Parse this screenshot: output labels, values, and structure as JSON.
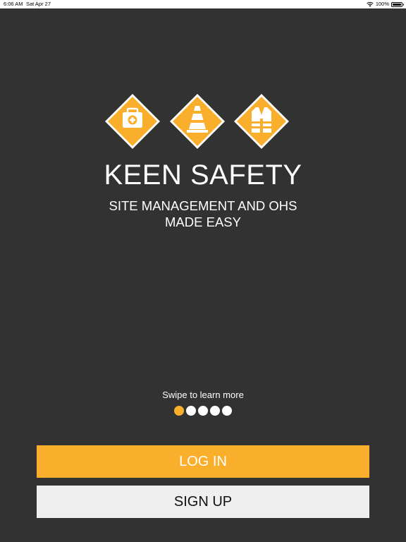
{
  "status_bar": {
    "time": "6:06 AM",
    "date": "Sat Apr 27",
    "battery": "100%",
    "wifi_icon": "wifi-icon",
    "battery_icon": "battery-icon"
  },
  "logo": {
    "icons": [
      "first-aid-kit-icon",
      "traffic-cone-icon",
      "safety-vest-icon"
    ],
    "accent_color": "#f9ae2c"
  },
  "brand": {
    "title": "KEEN SAFETY",
    "tagline_line1": "SITE MANAGEMENT AND OHS",
    "tagline_line2": "MADE EASY"
  },
  "onboarding": {
    "hint": "Swipe to learn more",
    "total_pages": 5,
    "current_page": 1
  },
  "buttons": {
    "login": "LOG IN",
    "signup": "SIGN UP"
  },
  "colors": {
    "background": "#333233",
    "accent": "#f9ae2c",
    "signup_bg": "#efefef"
  }
}
